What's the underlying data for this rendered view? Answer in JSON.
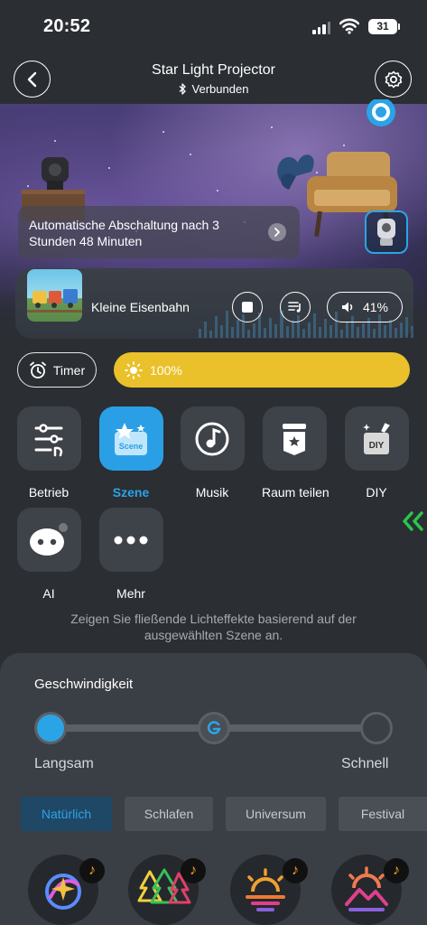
{
  "status_bar": {
    "time": "20:52",
    "battery": "31"
  },
  "header": {
    "title": "Star Light Projector",
    "connection": "Verbunden"
  },
  "hero": {
    "auto_off_text": "Automatische Abschaltung nach 3 Stunden 48 Minuten"
  },
  "music": {
    "track": "Kleine Eisenbahn",
    "volume": "41%"
  },
  "controls": {
    "timer_label": "Timer",
    "brightness_label": "100%",
    "brightness_fraction": 1.0
  },
  "modes": [
    {
      "label": "Betrieb",
      "icon": "sliders-icon",
      "active": false
    },
    {
      "label": "Szene",
      "icon": "scene-icon",
      "active": true
    },
    {
      "label": "Musik",
      "icon": "music-icon",
      "active": false
    },
    {
      "label": "Raum teilen",
      "icon": "room-share-icon",
      "active": false
    },
    {
      "label": "DIY",
      "icon": "diy-icon",
      "active": false
    },
    {
      "label": "AI",
      "icon": "robot-icon",
      "active": false
    },
    {
      "label": "Mehr",
      "icon": "more-icon",
      "active": false
    }
  ],
  "scene_icon_text": "Scene",
  "diy_icon_text": "DIY",
  "description": "Zeigen Sie fließende Lichteffekte basierend auf der ausgewählten Szene an.",
  "speed": {
    "title": "Geschwindigkeit",
    "min_label": "Langsam",
    "max_label": "Schnell"
  },
  "categories": [
    {
      "label": "Natürlich",
      "active": true
    },
    {
      "label": "Schlafen",
      "active": false
    },
    {
      "label": "Universum",
      "active": false
    },
    {
      "label": "Festival",
      "active": false
    }
  ],
  "scenes": [
    {
      "icon": "galaxy-icon"
    },
    {
      "icon": "forest-icon"
    },
    {
      "icon": "sunset-icon"
    },
    {
      "icon": "mountain-sunrise-icon"
    }
  ],
  "colors": {
    "accent": "#2ba4e6",
    "brightness": "#eac12a",
    "chevron": "#29c64a"
  }
}
